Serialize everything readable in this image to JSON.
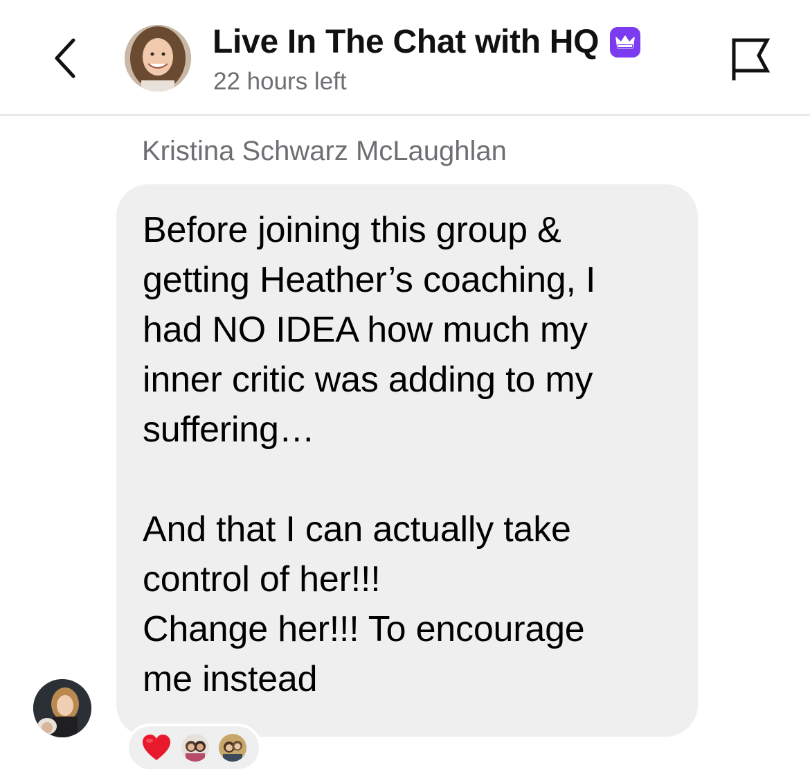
{
  "header": {
    "title": "Live In The Chat with HQ",
    "subtitle": "22 hours left",
    "badge_color": "#7b3cf1",
    "back_icon": "chevron-left-icon",
    "flag_icon": "flag-icon",
    "badge_icon": "crown-icon"
  },
  "message": {
    "sender": "Kristina Schwarz McLaughlan",
    "lines": [
      "Before joining this group &",
      "getting Heather’s coaching, I",
      "had NO IDEA how much my",
      "inner critic was adding to my",
      "suffering…",
      "",
      "And that I can actually take",
      "control of her!!!",
      "Change her!!! To encourage",
      "me instead"
    ],
    "bubble_color": "#efefef"
  },
  "reactions": {
    "items": [
      "heart",
      "user-avatar",
      "user-avatar"
    ],
    "heart_color": "#e8192c"
  }
}
